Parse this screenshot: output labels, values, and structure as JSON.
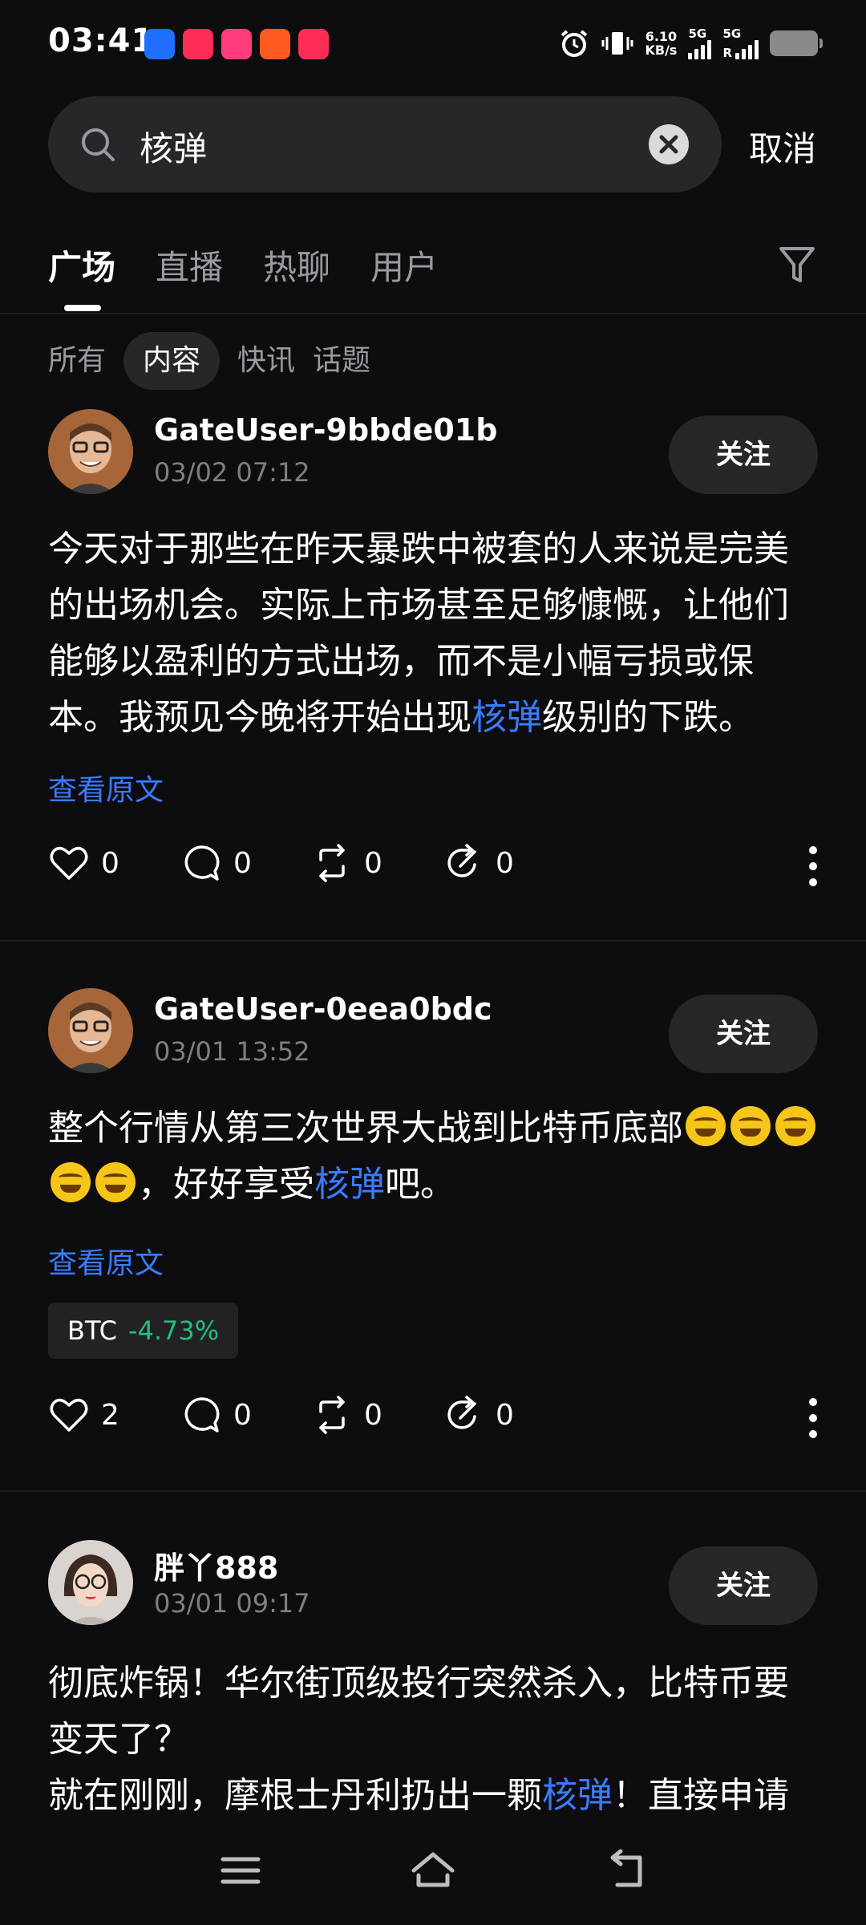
{
  "status_bar": {
    "time": "03:41",
    "net_speed_value": "6.10",
    "net_speed_unit": "KB/s",
    "signal1": "5G",
    "signal2": "5G",
    "signal2_sub": "R"
  },
  "search": {
    "query": "核弹",
    "cancel_label": "取消"
  },
  "tabs": [
    "广场",
    "直播",
    "热聊",
    "用户"
  ],
  "subtabs": [
    "所有",
    "内容",
    "快讯",
    "话题"
  ],
  "follow_label": "关注",
  "view_original_label": "查看原文",
  "posts": [
    {
      "username": "GateUser-9bbde01b",
      "date": "03/02 07:12",
      "text_before": "今天对于那些在昨天暴跌中被套的人来说是完美的出场机会。实际上市场甚至足够慷慨，让他们能够以盈利的方式出场，而不是小幅亏损或保本。我预见今晚将开始出现",
      "highlight": "核弹",
      "text_after": "级别的下跌。",
      "likes": "0",
      "comments": "0",
      "reposts": "0",
      "shares": "0"
    },
    {
      "username": "GateUser-0eea0bdc",
      "date": "03/01 13:52",
      "text_before": "整个行情从第三次世界大战到比特币底部",
      "text_mid": "，好好享受",
      "highlight": "核弹",
      "text_after": "吧。",
      "ticker_symbol": "BTC",
      "ticker_change": "-4.73%",
      "likes": "2",
      "comments": "0",
      "reposts": "0",
      "shares": "0"
    },
    {
      "username": "胖丫888",
      "date": "03/01 09:17",
      "line1": "彻底炸锅！华尔街顶级投行突然杀入，比特币要变天了？",
      "line2_before": "就在刚刚，摩根士丹利扔出一颗",
      "highlight": "核弹",
      "line2_after": "！直接申请"
    }
  ],
  "colors": {
    "background": "#0d0d0f",
    "highlight": "#3b7bff",
    "positive_ticker": "#21c17a",
    "chip_bg": "#26262b"
  }
}
